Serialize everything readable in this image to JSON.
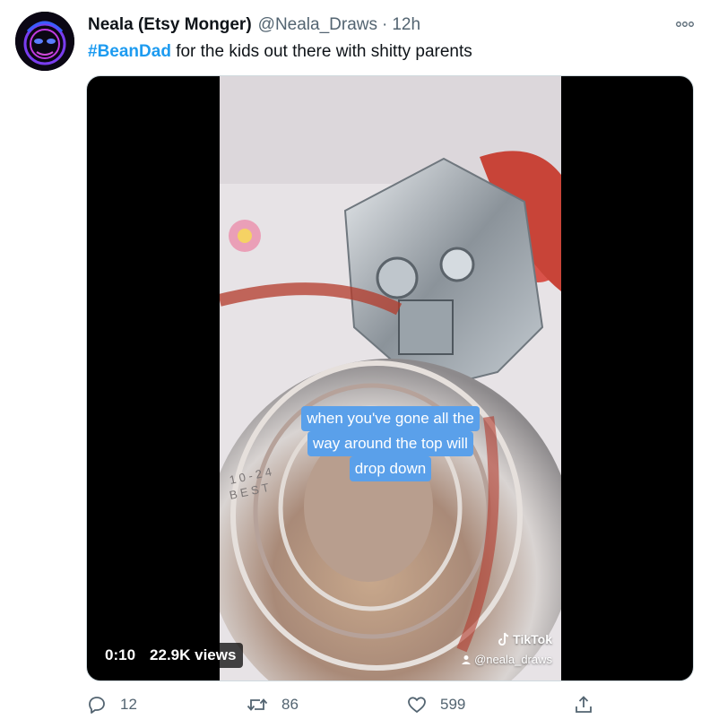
{
  "author": {
    "display_name": "Neala (Etsy Monger)",
    "handle": "@Neala_Draws",
    "separator": "·",
    "time": "12h"
  },
  "tweet": {
    "hashtag": "#BeanDad",
    "text": " for the kids out there with shitty parents"
  },
  "media": {
    "caption_lines": [
      "when you've gone all the",
      "way around the top will",
      "drop down"
    ],
    "tiktok_brand": "TikTok",
    "tiktok_user": "@neala_draws",
    "duration": "0:10",
    "views": "22.9K views"
  },
  "actions": {
    "replies": "12",
    "retweets": "86",
    "likes": "599"
  },
  "colors": {
    "link": "#1d9bf0",
    "muted": "#536471",
    "caption_bg": "#5aa0ea"
  },
  "icons": [
    "more-icon",
    "reply-icon",
    "retweet-icon",
    "like-icon",
    "share-icon",
    "tiktok-logo-icon",
    "user-icon"
  ]
}
